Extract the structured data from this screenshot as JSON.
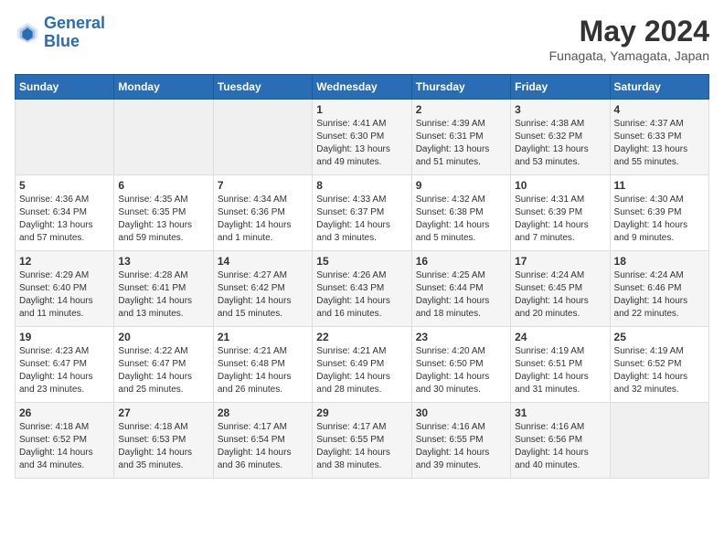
{
  "header": {
    "logo_line1": "General",
    "logo_line2": "Blue",
    "month": "May 2024",
    "location": "Funagata, Yamagata, Japan"
  },
  "weekdays": [
    "Sunday",
    "Monday",
    "Tuesday",
    "Wednesday",
    "Thursday",
    "Friday",
    "Saturday"
  ],
  "weeks": [
    [
      {
        "day": "",
        "empty": true
      },
      {
        "day": "",
        "empty": true
      },
      {
        "day": "",
        "empty": true
      },
      {
        "day": "1",
        "sunrise": "4:41 AM",
        "sunset": "6:30 PM",
        "daylight": "13 hours and 49 minutes."
      },
      {
        "day": "2",
        "sunrise": "4:39 AM",
        "sunset": "6:31 PM",
        "daylight": "13 hours and 51 minutes."
      },
      {
        "day": "3",
        "sunrise": "4:38 AM",
        "sunset": "6:32 PM",
        "daylight": "13 hours and 53 minutes."
      },
      {
        "day": "4",
        "sunrise": "4:37 AM",
        "sunset": "6:33 PM",
        "daylight": "13 hours and 55 minutes."
      }
    ],
    [
      {
        "day": "5",
        "sunrise": "4:36 AM",
        "sunset": "6:34 PM",
        "daylight": "13 hours and 57 minutes."
      },
      {
        "day": "6",
        "sunrise": "4:35 AM",
        "sunset": "6:35 PM",
        "daylight": "13 hours and 59 minutes."
      },
      {
        "day": "7",
        "sunrise": "4:34 AM",
        "sunset": "6:36 PM",
        "daylight": "14 hours and 1 minute."
      },
      {
        "day": "8",
        "sunrise": "4:33 AM",
        "sunset": "6:37 PM",
        "daylight": "14 hours and 3 minutes."
      },
      {
        "day": "9",
        "sunrise": "4:32 AM",
        "sunset": "6:38 PM",
        "daylight": "14 hours and 5 minutes."
      },
      {
        "day": "10",
        "sunrise": "4:31 AM",
        "sunset": "6:39 PM",
        "daylight": "14 hours and 7 minutes."
      },
      {
        "day": "11",
        "sunrise": "4:30 AM",
        "sunset": "6:39 PM",
        "daylight": "14 hours and 9 minutes."
      }
    ],
    [
      {
        "day": "12",
        "sunrise": "4:29 AM",
        "sunset": "6:40 PM",
        "daylight": "14 hours and 11 minutes."
      },
      {
        "day": "13",
        "sunrise": "4:28 AM",
        "sunset": "6:41 PM",
        "daylight": "14 hours and 13 minutes."
      },
      {
        "day": "14",
        "sunrise": "4:27 AM",
        "sunset": "6:42 PM",
        "daylight": "14 hours and 15 minutes."
      },
      {
        "day": "15",
        "sunrise": "4:26 AM",
        "sunset": "6:43 PM",
        "daylight": "14 hours and 16 minutes."
      },
      {
        "day": "16",
        "sunrise": "4:25 AM",
        "sunset": "6:44 PM",
        "daylight": "14 hours and 18 minutes."
      },
      {
        "day": "17",
        "sunrise": "4:24 AM",
        "sunset": "6:45 PM",
        "daylight": "14 hours and 20 minutes."
      },
      {
        "day": "18",
        "sunrise": "4:24 AM",
        "sunset": "6:46 PM",
        "daylight": "14 hours and 22 minutes."
      }
    ],
    [
      {
        "day": "19",
        "sunrise": "4:23 AM",
        "sunset": "6:47 PM",
        "daylight": "14 hours and 23 minutes."
      },
      {
        "day": "20",
        "sunrise": "4:22 AM",
        "sunset": "6:47 PM",
        "daylight": "14 hours and 25 minutes."
      },
      {
        "day": "21",
        "sunrise": "4:21 AM",
        "sunset": "6:48 PM",
        "daylight": "14 hours and 26 minutes."
      },
      {
        "day": "22",
        "sunrise": "4:21 AM",
        "sunset": "6:49 PM",
        "daylight": "14 hours and 28 minutes."
      },
      {
        "day": "23",
        "sunrise": "4:20 AM",
        "sunset": "6:50 PM",
        "daylight": "14 hours and 30 minutes."
      },
      {
        "day": "24",
        "sunrise": "4:19 AM",
        "sunset": "6:51 PM",
        "daylight": "14 hours and 31 minutes."
      },
      {
        "day": "25",
        "sunrise": "4:19 AM",
        "sunset": "6:52 PM",
        "daylight": "14 hours and 32 minutes."
      }
    ],
    [
      {
        "day": "26",
        "sunrise": "4:18 AM",
        "sunset": "6:52 PM",
        "daylight": "14 hours and 34 minutes."
      },
      {
        "day": "27",
        "sunrise": "4:18 AM",
        "sunset": "6:53 PM",
        "daylight": "14 hours and 35 minutes."
      },
      {
        "day": "28",
        "sunrise": "4:17 AM",
        "sunset": "6:54 PM",
        "daylight": "14 hours and 36 minutes."
      },
      {
        "day": "29",
        "sunrise": "4:17 AM",
        "sunset": "6:55 PM",
        "daylight": "14 hours and 38 minutes."
      },
      {
        "day": "30",
        "sunrise": "4:16 AM",
        "sunset": "6:55 PM",
        "daylight": "14 hours and 39 minutes."
      },
      {
        "day": "31",
        "sunrise": "4:16 AM",
        "sunset": "6:56 PM",
        "daylight": "14 hours and 40 minutes."
      },
      {
        "day": "",
        "empty": true
      }
    ]
  ]
}
